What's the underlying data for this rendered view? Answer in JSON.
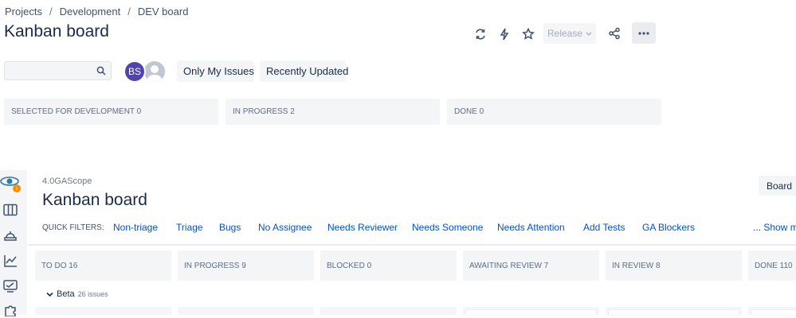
{
  "breadcrumbs": [
    "Projects",
    "Development",
    "DEV board"
  ],
  "page_title": "Kanban board",
  "header": {
    "release_label": "Release",
    "icons": [
      "refresh-icon",
      "lightning-icon",
      "star-icon",
      "share-icon",
      "more-icon"
    ]
  },
  "filters": {
    "search_placeholder": "",
    "avatar_initials": "BS",
    "only_my_issues": "Only My Issues",
    "recently_updated": "Recently Updated"
  },
  "columns_top": [
    {
      "label": "SELECTED FOR DEVELOPMENT 0"
    },
    {
      "label": "IN PROGRESS 2"
    },
    {
      "label": "DONE 0"
    }
  ],
  "embedded": {
    "project_name": "4.0GAScope",
    "title": "Kanban board",
    "board_button": "Board",
    "quick_filters_label": "QUICK FILTERS:",
    "quick_filters": [
      "Non-triage",
      "Triage",
      "Bugs",
      "No Assignee",
      "Needs Reviewer",
      "Needs Someone",
      "Needs Attention",
      "Add Tests",
      "GA Blockers"
    ],
    "show_more": "... Show m",
    "columns": [
      {
        "label": "TO DO 16"
      },
      {
        "label": "IN PROGRESS 9"
      },
      {
        "label": "BLOCKED 0"
      },
      {
        "label": "AWAITING REVIEW 7"
      },
      {
        "label": "IN REVIEW 8"
      },
      {
        "label": "DONE 110"
      }
    ],
    "swimlane": {
      "name": "Beta",
      "count": "26 issues"
    }
  },
  "colors": {
    "accent": "#0052cc",
    "avatar": "#5243aa",
    "panel": "#f4f5f7"
  }
}
